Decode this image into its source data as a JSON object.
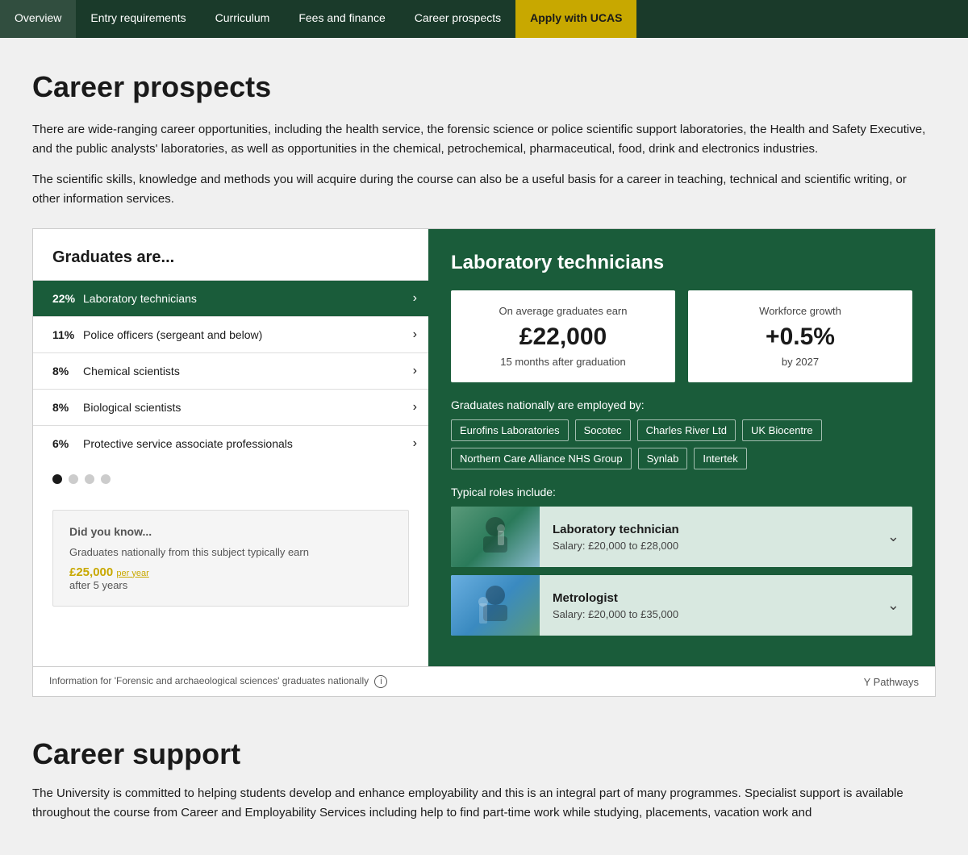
{
  "nav": {
    "items": [
      {
        "label": "Overview",
        "active": false
      },
      {
        "label": "Entry requirements",
        "active": false
      },
      {
        "label": "Curriculum",
        "active": false
      },
      {
        "label": "Fees and finance",
        "active": false
      },
      {
        "label": "Career prospects",
        "active": false
      },
      {
        "label": "Apply with UCAS",
        "active": true
      }
    ]
  },
  "page": {
    "title": "Career prospects",
    "intro1": "There are wide-ranging career opportunities, including the health service, the forensic science or police scientific support laboratories, the Health and Safety Executive, and the public analysts' laboratories, as well as opportunities in the chemical, petrochemical, pharmaceutical, food, drink and electronics industries.",
    "intro2": "The scientific skills, knowledge and methods you will acquire during the course can also be a useful basis for a career in teaching, technical and scientific writing, or other information services."
  },
  "graduates_widget": {
    "title": "Graduates are...",
    "items": [
      {
        "pct": "22%",
        "label": "Laboratory technicians",
        "selected": true
      },
      {
        "pct": "11%",
        "label": "Police officers (sergeant and below)",
        "selected": false
      },
      {
        "pct": "8%",
        "label": "Chemical scientists",
        "selected": false
      },
      {
        "pct": "8%",
        "label": "Biological scientists",
        "selected": false
      },
      {
        "pct": "6%",
        "label": "Protective service associate professionals",
        "selected": false
      }
    ],
    "dots": [
      true,
      false,
      false,
      false
    ],
    "did_you_know": {
      "title": "Did you know...",
      "text": "Graduates nationally from this subject typically earn",
      "amount": "£25,000",
      "per_year": "per year",
      "after": "after 5 years"
    }
  },
  "right_panel": {
    "title": "Laboratory technicians",
    "stat1_label": "On average graduates earn",
    "stat1_value": "£22,000",
    "stat1_sub": "15 months after graduation",
    "stat2_label": "Workforce growth",
    "stat2_value": "+0.5%",
    "stat2_sub": "by 2027",
    "employed_label": "Graduates nationally are employed by:",
    "employers": [
      "Eurofins Laboratories",
      "Socotec",
      "Charles River Ltd",
      "UK Biocentre",
      "Northern Care Alliance NHS Group",
      "Synlab",
      "Intertek"
    ],
    "typical_label": "Typical roles include:",
    "roles": [
      {
        "name": "Laboratory technician",
        "salary": "Salary: £20,000 to £28,000"
      },
      {
        "name": "Metrologist",
        "salary": "Salary: £20,000 to £35,000"
      }
    ]
  },
  "widget_footer": {
    "info_text": "Information for 'Forensic and archaeological sciences' graduates nationally",
    "pathways": "Y Pathways"
  },
  "career_support": {
    "title": "Career support",
    "text": "The University is committed to helping students develop and enhance employability and this is an integral part of many programmes. Specialist support is available throughout the course from Career and Employability Services including help to find part-time work while studying, placements, vacation work and"
  }
}
